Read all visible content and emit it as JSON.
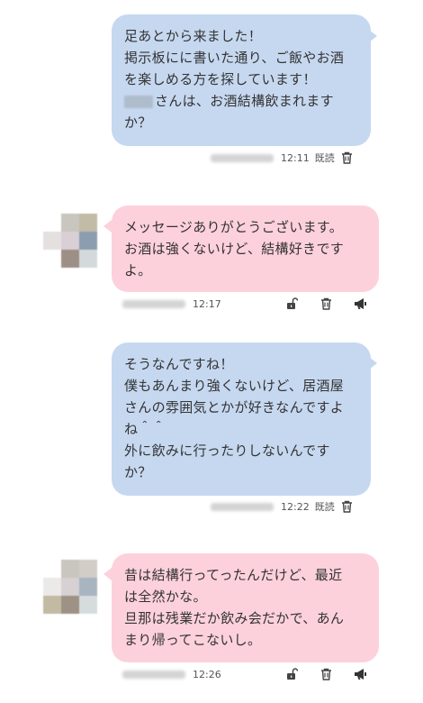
{
  "messages": [
    {
      "direction": "outgoing",
      "lines": [
        "足あとから来ました！",
        "掲示板にに書いた通り、ご飯やお酒",
        "を楽しめる方を探しています！",
        "さんは、お酒結構飲まれます",
        "か？"
      ],
      "time": "12:11",
      "read": "既読"
    },
    {
      "direction": "incoming",
      "lines": [
        "メッセージありがとうございます。",
        "お酒は強くないけど、結構好きです",
        "よ。"
      ],
      "time": "12:17"
    },
    {
      "direction": "outgoing",
      "lines": [
        "そうなんですね！",
        "僕もあんまり強くないけど、居酒屋",
        "さんの雰囲気とかが好きなんですよ",
        "ね＾＾",
        "外に飲みに行ったりしないんです",
        "か？"
      ],
      "time": "12:22",
      "read": "既読"
    },
    {
      "direction": "incoming",
      "lines": [
        "昔は結構行ってったんだけど、最近",
        "は全然かな。",
        "旦那は残業だか飲み会だかで、あん",
        "まり帰ってこないし。"
      ],
      "time": "12:26"
    }
  ],
  "icons": {
    "trash": "trash-icon",
    "unlock": "unlock-icon",
    "report": "megaphone-icon"
  },
  "colors": {
    "outgoing_bubble": "#c6d8f0",
    "incoming_bubble": "#fdd1dc"
  }
}
